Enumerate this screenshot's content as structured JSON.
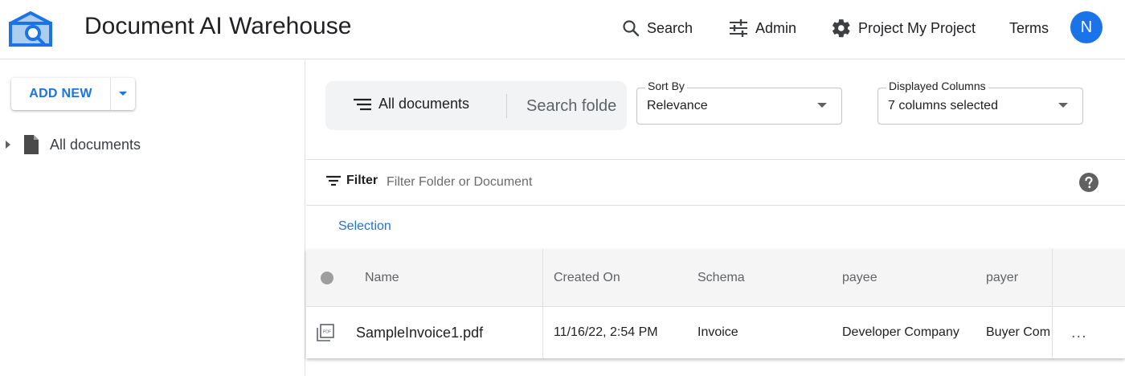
{
  "app": {
    "title": "Document AI Warehouse",
    "logo_icon": "warehouse-search-logo",
    "accent_color": "#1a73e8"
  },
  "nav": {
    "search_label": "Search",
    "admin_label": "Admin",
    "project_label": "Project My Project",
    "terms_label": "Terms",
    "avatar_initial": "N"
  },
  "sidebar": {
    "add_new_label": "ADD NEW",
    "tree": [
      {
        "label": "All documents",
        "icon": "document-icon"
      }
    ]
  },
  "toolbar": {
    "all_documents_label": "All documents",
    "search_placeholder": "Search folders",
    "sort_by": {
      "label": "Sort By",
      "value": "Relevance"
    },
    "displayed_columns": {
      "label": "Displayed Columns",
      "value": "7 columns selected"
    }
  },
  "filter": {
    "label": "Filter",
    "placeholder": "Filter Folder or Document"
  },
  "selection_label": "Selection",
  "table": {
    "columns": [
      "Name",
      "Created On",
      "Schema",
      "payee",
      "payer"
    ],
    "rows": [
      {
        "name": "SampleInvoice1.pdf",
        "created_on": "11/16/22, 2:54 PM",
        "schema": "Invoice",
        "payee": "Developer Company",
        "payer": "Buyer Company",
        "more": "..."
      }
    ]
  }
}
